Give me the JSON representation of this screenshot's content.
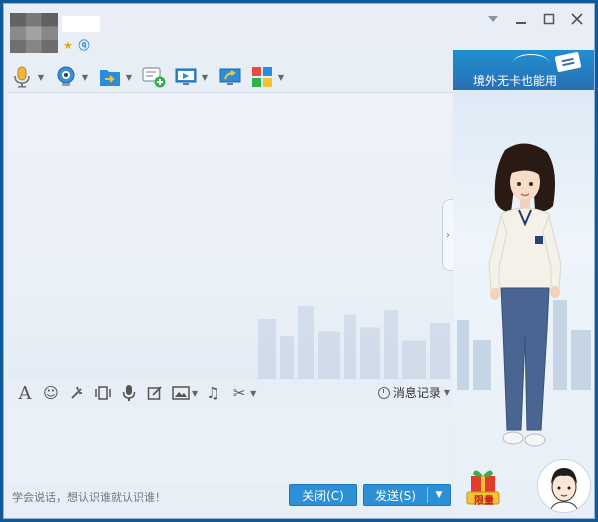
{
  "toolbar": {
    "tools": [
      "voice-call",
      "video-call",
      "send-file",
      "create-discussion",
      "remote-assist",
      "share-screen",
      "app-center"
    ]
  },
  "input_toolbar": {
    "icons": [
      "font",
      "emoji",
      "nudge",
      "shake",
      "voice-message",
      "screenshot-edit",
      "image",
      "music",
      "screenshot"
    ],
    "history_label": "消息记录"
  },
  "footer": {
    "tip": "学会说话，想认识谁就认识谁！",
    "close_label": "关闭(C)",
    "send_label": "发送(S)"
  },
  "side_panel": {
    "banner_text": "境外无卡也能用",
    "gift_label": "限量"
  },
  "colors": {
    "button": "#2d8fd6",
    "window_bg": "#e8eef6",
    "frame": "#0f5a98"
  }
}
